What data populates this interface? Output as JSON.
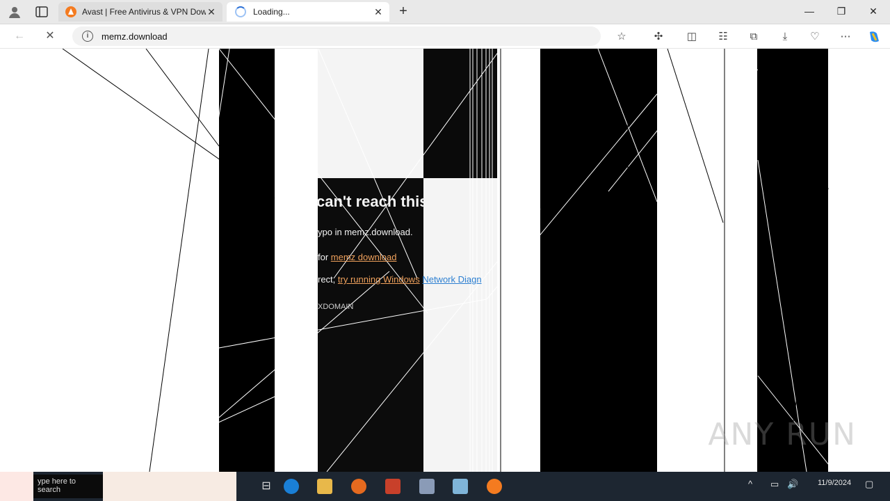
{
  "browser": {
    "tabs": [
      {
        "title": "Avast | Free Antivirus & VPN Dow"
      },
      {
        "title": "Loading..."
      }
    ],
    "address": "memz.download"
  },
  "error_page": {
    "title": "can't reach this page",
    "line1": "ypo in memz.download.",
    "line2_prefix": "for",
    "line2_link": "memz download",
    "line3_prefix": "rect,",
    "line3_link": "try running Windows",
    "line3_link2": "Network Diagn",
    "error_code": "XDOMAIN"
  },
  "watermark": "ANY RUN",
  "taskbar": {
    "search_text": "ype here to search",
    "date": "11/9/2024"
  },
  "colors": {
    "accent_link": "#f0a15c",
    "link_blue": "#2c7fd1",
    "avast_orange": "#f47b20"
  }
}
